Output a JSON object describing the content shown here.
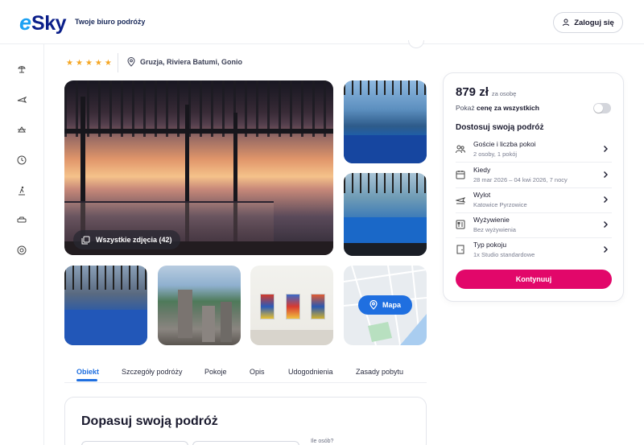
{
  "header": {
    "logo_e": "e",
    "logo_sky": "Sky",
    "tagline": "Twoje biuro podróży",
    "login_label": "Zaloguj się"
  },
  "sidebar": {
    "icons": [
      "beach-icon",
      "plane-icon",
      "plane-hotel-icon",
      "clock-icon",
      "ski-icon",
      "car-icon",
      "support-icon"
    ]
  },
  "hotel": {
    "stars": [
      "★",
      "★",
      "★",
      "★",
      "★"
    ],
    "location": "Gruzja, Riviera Batumi, Gonio"
  },
  "gallery": {
    "all_photos_label": "Wszystkie zdjęcia (42)",
    "map_label": "Mapa"
  },
  "tabs": [
    {
      "label": "Obiekt",
      "active": true
    },
    {
      "label": "Szczegóły podróży",
      "active": false
    },
    {
      "label": "Pokoje",
      "active": false
    },
    {
      "label": "Opis",
      "active": false
    },
    {
      "label": "Udogodnienia",
      "active": false
    },
    {
      "label": "Zasady pobytu",
      "active": false
    }
  ],
  "customize": {
    "title": "Dopasuj swoją podróż",
    "guests_label": "Ile osób?"
  },
  "booking": {
    "price": "879 zł",
    "price_unit": "za osobę",
    "toggle_prefix": "Pokaż ",
    "toggle_bold": "cenę za wszystkich",
    "section_title": "Dostosuj swoją podróż",
    "options": [
      {
        "icon": "guests-icon",
        "label": "Goście i liczba pokoi",
        "value": "2 osoby, 1 pokój"
      },
      {
        "icon": "calendar-icon",
        "label": "Kiedy",
        "value": "28 mar 2026 – 04 kwi 2026, 7 nocy"
      },
      {
        "icon": "departure-icon",
        "label": "Wylot",
        "value": "Katowice Pyrzowice"
      },
      {
        "icon": "meal-icon",
        "label": "Wyżywienie",
        "value": "Bez wyżywienia"
      },
      {
        "icon": "room-icon",
        "label": "Typ pokoju",
        "value": "1x Studio standardowe"
      }
    ],
    "continue_label": "Kontynuuj"
  },
  "colors": {
    "accent_blue": "#1f6fe0",
    "cta_pink": "#e2076a",
    "star": "#f5a623"
  }
}
